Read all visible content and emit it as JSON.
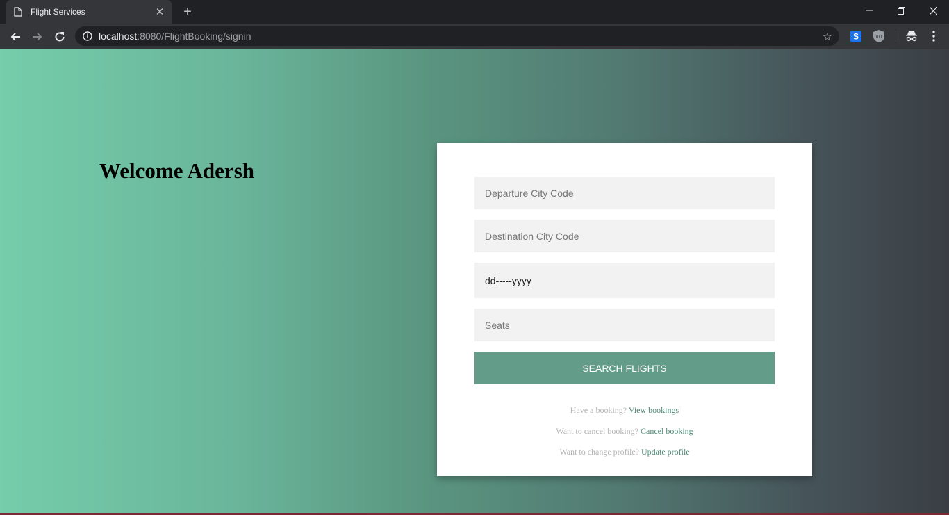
{
  "browser": {
    "tab_title": "Flight Services",
    "url_host": "localhost",
    "url_rest": ":8080/FlightBooking/signin",
    "icons": {
      "tab": "document-icon",
      "close": "close-icon",
      "new_tab": "plus-icon",
      "back": "back-arrow-icon",
      "forward": "forward-arrow-icon",
      "reload": "reload-icon",
      "info": "info-icon",
      "bookmark": "star-icon",
      "minimize": "minimize-icon",
      "restore": "restore-icon",
      "window_close": "window-close-icon",
      "menu": "kebab-menu-icon"
    },
    "extensions": [
      "s-extension-icon",
      "ublock-icon",
      "incognito-icon"
    ]
  },
  "page": {
    "welcome": "Welcome Adersh",
    "form": {
      "departure_placeholder": "Departure City Code",
      "destination_placeholder": "Destination City Code",
      "date_value": "dd-----yyyy",
      "seats_placeholder": "Seats",
      "search_label": "SEARCH FLIGHTS"
    },
    "links": [
      {
        "prompt": "Have a booking?",
        "link": "View bookings"
      },
      {
        "prompt": "Want to cancel booking?",
        "link": "Cancel booking"
      },
      {
        "prompt": "Want to change profile?",
        "link": "Update profile"
      }
    ]
  },
  "colors": {
    "gradient_start": "#75cdaa",
    "gradient_end": "#3a3e44",
    "button": "#649c8a",
    "link": "#4d8a74",
    "field_bg": "#f2f2f2"
  }
}
